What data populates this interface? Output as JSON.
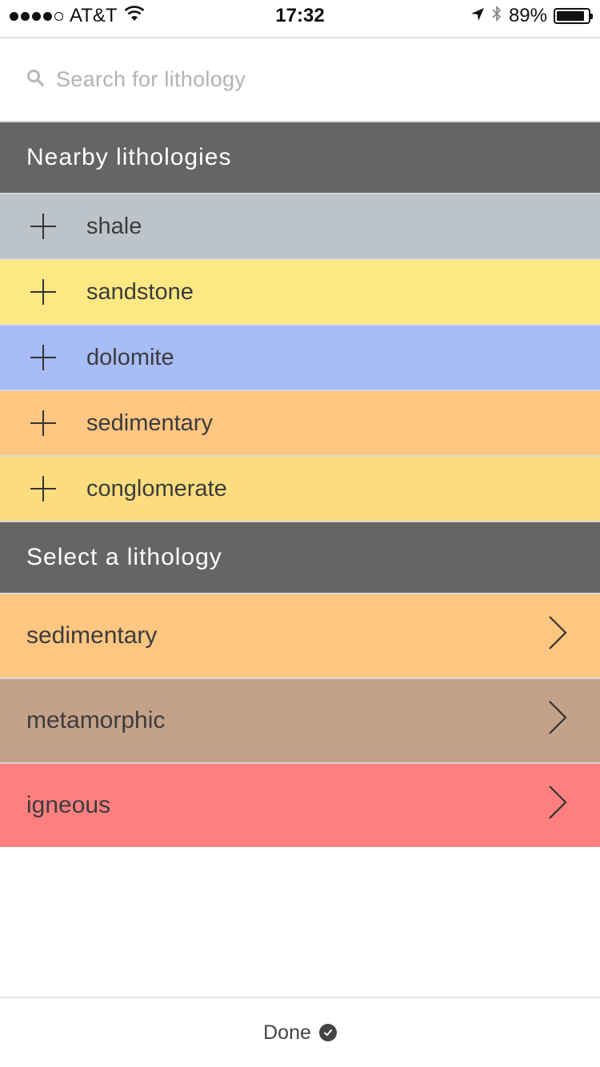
{
  "status_bar": {
    "carrier": "AT&T",
    "time": "17:32",
    "battery_percent": "89%",
    "battery_level": 0.89,
    "signal_bars_filled": 4,
    "signal_bars_total": 5,
    "icons": [
      "wifi-icon",
      "location-arrow-icon",
      "bluetooth-icon",
      "battery-icon"
    ]
  },
  "search": {
    "placeholder": "Search for lithology",
    "value": ""
  },
  "nearby": {
    "header": "Nearby lithologies",
    "items": [
      {
        "label": "shale",
        "color": "#bcc3c9"
      },
      {
        "label": "sandstone",
        "color": "#fee883"
      },
      {
        "label": "dolomite",
        "color": "#a8bcf5"
      },
      {
        "label": "sedimentary",
        "color": "#fdc681"
      },
      {
        "label": "conglomerate",
        "color": "#fcdd7e"
      }
    ]
  },
  "select": {
    "header": "Select a lithology",
    "items": [
      {
        "label": "sedimentary",
        "color": "#fdc681"
      },
      {
        "label": "metamorphic",
        "color": "#c4a189"
      },
      {
        "label": "igneous",
        "color": "#ff7f7f"
      }
    ]
  },
  "footer": {
    "done_label": "Done"
  },
  "colors": {
    "section_header_bg": "#656565",
    "section_header_text": "#ffffff"
  }
}
